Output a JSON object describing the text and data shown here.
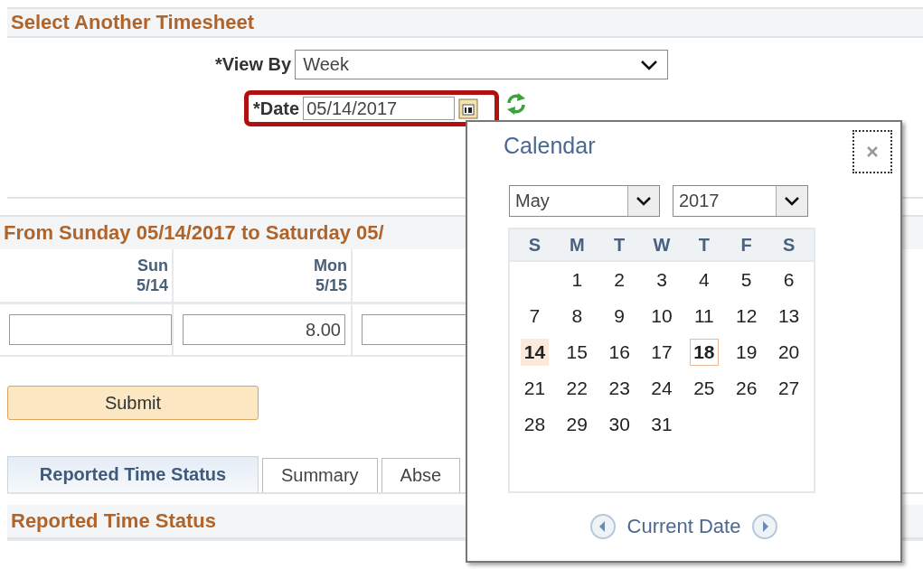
{
  "select_section": {
    "title": "Select Another Timesheet",
    "view_by": {
      "label": "*View By",
      "value": "Week"
    },
    "date": {
      "label": "*Date",
      "value": "05/14/2017"
    }
  },
  "week": {
    "title": "From Sunday 05/14/2017 to Saturday 05/",
    "columns": [
      {
        "day": "Sun",
        "date": "5/14"
      },
      {
        "day": "Mon",
        "date": "5/15"
      }
    ],
    "hours": [
      {
        "kind": "empty"
      },
      {
        "kind": "value",
        "value": "8.00"
      },
      {
        "kind": "empty"
      }
    ]
  },
  "submit_button": "Submit",
  "tabs": [
    {
      "label": "Reported Time Status",
      "selected": true
    },
    {
      "label": "Summary",
      "selected": false
    },
    {
      "label": "Abse",
      "selected": false
    }
  ],
  "status_section": {
    "title": "Reported Time Status"
  },
  "calendar": {
    "title": "Calendar",
    "month": "May",
    "year": "2017",
    "weekdays": [
      "S",
      "M",
      "T",
      "W",
      "T",
      "F",
      "S"
    ],
    "weeks": [
      {
        "days": [
          {
            "kind": "blank"
          },
          {
            "kind": "day",
            "day": "1",
            "selected": false,
            "today": false
          },
          {
            "kind": "day",
            "day": "2",
            "selected": false,
            "today": false
          },
          {
            "kind": "day",
            "day": "3",
            "selected": false,
            "today": false
          },
          {
            "kind": "day",
            "day": "4",
            "selected": false,
            "today": false
          },
          {
            "kind": "day",
            "day": "5",
            "selected": false,
            "today": false
          },
          {
            "kind": "day",
            "day": "6",
            "selected": false,
            "today": false
          }
        ]
      },
      {
        "days": [
          {
            "kind": "day",
            "day": "7",
            "selected": false,
            "today": false
          },
          {
            "kind": "day",
            "day": "8",
            "selected": false,
            "today": false
          },
          {
            "kind": "day",
            "day": "9",
            "selected": false,
            "today": false
          },
          {
            "kind": "day",
            "day": "10",
            "selected": false,
            "today": false
          },
          {
            "kind": "day",
            "day": "11",
            "selected": false,
            "today": false
          },
          {
            "kind": "day",
            "day": "12",
            "selected": false,
            "today": false
          },
          {
            "kind": "day",
            "day": "13",
            "selected": false,
            "today": false
          }
        ]
      },
      {
        "days": [
          {
            "kind": "day",
            "day": "14",
            "selected": true,
            "today": false
          },
          {
            "kind": "day",
            "day": "15",
            "selected": false,
            "today": false
          },
          {
            "kind": "day",
            "day": "16",
            "selected": false,
            "today": false
          },
          {
            "kind": "day",
            "day": "17",
            "selected": false,
            "today": false
          },
          {
            "kind": "day",
            "day": "18",
            "selected": false,
            "today": true
          },
          {
            "kind": "day",
            "day": "19",
            "selected": false,
            "today": false
          },
          {
            "kind": "day",
            "day": "20",
            "selected": false,
            "today": false
          }
        ]
      },
      {
        "days": [
          {
            "kind": "day",
            "day": "21",
            "selected": false,
            "today": false
          },
          {
            "kind": "day",
            "day": "22",
            "selected": false,
            "today": false
          },
          {
            "kind": "day",
            "day": "23",
            "selected": false,
            "today": false
          },
          {
            "kind": "day",
            "day": "24",
            "selected": false,
            "today": false
          },
          {
            "kind": "day",
            "day": "25",
            "selected": false,
            "today": false
          },
          {
            "kind": "day",
            "day": "26",
            "selected": false,
            "today": false
          },
          {
            "kind": "day",
            "day": "27",
            "selected": false,
            "today": false
          }
        ]
      },
      {
        "days": [
          {
            "kind": "day",
            "day": "28",
            "selected": false,
            "today": false
          },
          {
            "kind": "day",
            "day": "29",
            "selected": false,
            "today": false
          },
          {
            "kind": "day",
            "day": "30",
            "selected": false,
            "today": false
          },
          {
            "kind": "day",
            "day": "31",
            "selected": false,
            "today": false
          }
        ]
      }
    ],
    "current_date": "Current Date"
  }
}
